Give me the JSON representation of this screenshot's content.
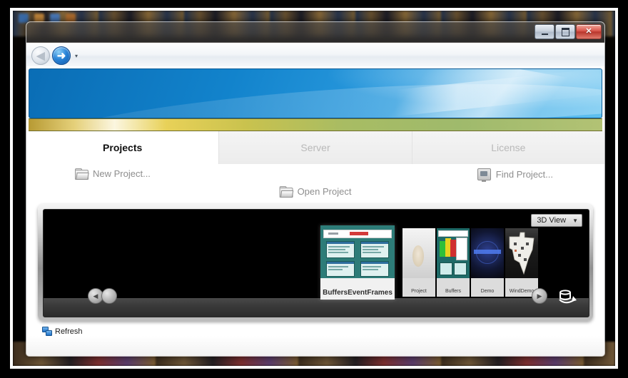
{
  "window": {
    "controls": {
      "minimize": "Minimize",
      "maximize": "Maximize",
      "close": "Close",
      "close_glyph": "✕"
    },
    "nav": {
      "back_glyph": "◀",
      "forward_glyph": "➜",
      "dropdown_caret": "▾"
    }
  },
  "tabs": [
    {
      "label": "Projects",
      "state": "active"
    },
    {
      "label": "Server",
      "state": "inactive"
    },
    {
      "label": "License",
      "state": "inactive"
    }
  ],
  "commands": {
    "new_project": "New Project...",
    "open_project": "Open Project",
    "find_project": "Find Project..."
  },
  "carousel": {
    "view_mode": "3D View",
    "view_caret": "▼",
    "prev_glyph": "◀",
    "next_glyph": "▶",
    "rotate_name": "rotate-view",
    "front_item": {
      "label": "BuffersEventFrames"
    },
    "back_items": [
      {
        "label": "Project"
      },
      {
        "label": "Buffers"
      },
      {
        "label": "Demo"
      },
      {
        "label": "WindDemo"
      }
    ]
  },
  "footer": {
    "refresh": "Refresh"
  },
  "colors": {
    "banner_blue": "#1283cc",
    "strip_gold": "#e8d158",
    "strip_green": "#a8bc63",
    "active_tab_text": "#111111",
    "inactive_tab_text": "#b9b9b9",
    "carousel_bg": "#000000",
    "close_button_red": "#d9554a"
  }
}
